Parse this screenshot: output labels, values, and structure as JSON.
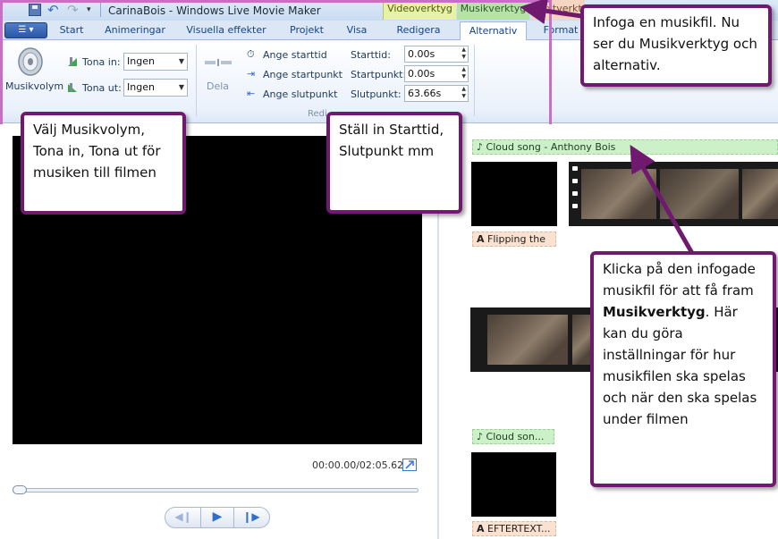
{
  "titlebar": {
    "title": "CarinaBois - Windows Live Movie Maker",
    "context_tabs": {
      "video": "Videoverktyg",
      "music": "Musikverktyg",
      "text": "Textverktyg"
    }
  },
  "tabs": [
    "Start",
    "Animeringar",
    "Visuella effekter",
    "Projekt",
    "Visa",
    "Redigera",
    "Alternativ",
    "Format"
  ],
  "ribbon": {
    "music_volume_label": "Musikvolym",
    "fade_in_label": "Tona in:",
    "fade_in_value": "Ingen",
    "fade_out_label": "Tona ut:",
    "fade_out_value": "Ingen",
    "split_label": "Dela",
    "set_start_time": "Ange starttid",
    "set_start_point": "Ange startpunkt",
    "set_end_point": "Ange slutpunkt",
    "start_time_label": "Starttid:",
    "start_time_value": "0.00s",
    "start_point_label": "Startpunkt:",
    "start_point_value": "0.00s",
    "end_point_label": "Slutpunkt:",
    "end_point_value": "63.66s",
    "edit_group_label": "Redi"
  },
  "preview": {
    "time": "00:00.00/02:05.62"
  },
  "storyboard": {
    "music_clip_1": "Cloud song - Anthony Bois",
    "text_clip_1": "Flipping the",
    "music_clip_2": "Cloud son...",
    "text_clip_2": "EFTERTEXT..."
  },
  "callouts": {
    "top_right": "Infoga en musikfil. Nu ser du Musikverktyg och alternativ.",
    "left": "Välj Musikvolym, Tona in, Tona ut för musiken till filmen",
    "middle": "Ställ in Starttid, Slutpunkt mm",
    "right_before": "Klicka på den infogade musikfil för att få fram ",
    "right_bold": "Musikverktyg",
    "right_after": ". Här kan du göra inställningar för hur musikfilen ska spelas och när den ska spelas under filmen"
  },
  "colors": {
    "callout_border": "#6f1a6f",
    "highlight": "#c86fc5",
    "music_tab": "#b6e2a7",
    "video_tab": "#e8f2a4"
  }
}
